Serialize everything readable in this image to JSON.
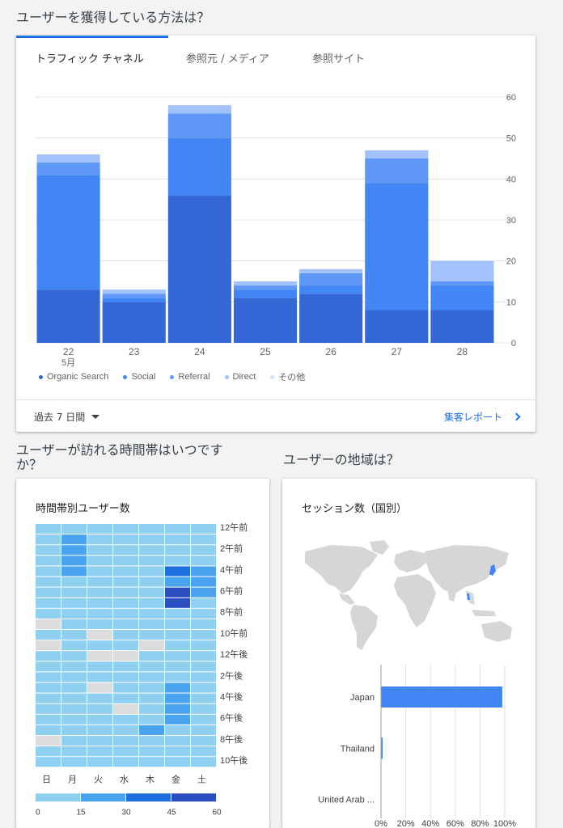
{
  "acquisition": {
    "title": "ユーザーを獲得している方法は？",
    "tabs": [
      "トラフィック チャネル",
      "参照元 / メディア",
      "参照サイト"
    ],
    "active_tab": 0,
    "period_label": "過去 7 日間",
    "report_link": "集客レポート"
  },
  "time_section": {
    "title_line1": "ユーザーが訪れる時間帯はいつです",
    "title_line2": "か？",
    "card_title": "時間帯別ユーザー数"
  },
  "geo_section": {
    "title": "ユーザーの地域は？",
    "card_title": "セッション数（国別）"
  },
  "colors": {
    "organic": "#3367d6",
    "social": "#4285f4",
    "referral": "#5e97f6",
    "direct": "#a1c2fa",
    "other": "#d2e3fc",
    "heat_1": "#8fd0f0",
    "heat_2": "#4aa3ee",
    "heat_3": "#1f6ee0",
    "heat_4": "#2a4dbf",
    "heat_na": "#dcdcdc",
    "map_land": "#d6d6d6",
    "map_highlight": "#4285f4"
  },
  "chart_data": [
    {
      "type": "bar",
      "stacked": true,
      "categories": [
        "22",
        "23",
        "24",
        "25",
        "26",
        "27",
        "28"
      ],
      "x_sublabel": {
        "index": 0,
        "text": "5月"
      },
      "series": [
        {
          "name": "Organic Search",
          "values": [
            13,
            10,
            36,
            11,
            12,
            8,
            8
          ]
        },
        {
          "name": "Social",
          "values": [
            28,
            1,
            14,
            2,
            2,
            31,
            6
          ]
        },
        {
          "name": "Referral",
          "values": [
            3,
            1,
            6,
            1,
            3,
            6,
            1
          ]
        },
        {
          "name": "Direct",
          "values": [
            2,
            1,
            2,
            1,
            1,
            2,
            5
          ]
        },
        {
          "name": "その他",
          "values": [
            0,
            0,
            0,
            0,
            0,
            0,
            0
          ]
        }
      ],
      "ylim": [
        0,
        60
      ],
      "yticks": [
        0,
        10,
        20,
        30,
        40,
        50,
        60
      ],
      "grid": true,
      "legend": "bottom"
    },
    {
      "type": "heatmap",
      "x_labels": [
        "日",
        "月",
        "火",
        "水",
        "木",
        "金",
        "土"
      ],
      "y_labels": [
        "12午前",
        "2午前",
        "4午前",
        "6午前",
        "8午前",
        "10午前",
        "12午後",
        "2午後",
        "4午後",
        "6午後",
        "8午後",
        "10午後"
      ],
      "levels": [
        [
          1,
          1,
          1,
          1,
          1,
          1,
          1
        ],
        [
          1,
          2,
          1,
          1,
          1,
          1,
          1
        ],
        [
          1,
          2,
          1,
          1,
          1,
          1,
          1
        ],
        [
          1,
          2,
          1,
          1,
          1,
          1,
          1
        ],
        [
          1,
          2,
          1,
          1,
          1,
          3,
          2
        ],
        [
          1,
          1,
          1,
          1,
          1,
          2,
          2
        ],
        [
          1,
          1,
          1,
          1,
          1,
          4,
          2
        ],
        [
          1,
          1,
          1,
          1,
          1,
          4,
          1
        ],
        [
          1,
          1,
          1,
          1,
          1,
          1,
          1
        ],
        [
          0,
          1,
          1,
          1,
          1,
          1,
          1
        ],
        [
          1,
          1,
          0,
          1,
          1,
          1,
          1
        ],
        [
          0,
          1,
          1,
          1,
          0,
          1,
          1
        ],
        [
          1,
          1,
          0,
          0,
          1,
          1,
          1
        ],
        [
          1,
          1,
          1,
          1,
          1,
          1,
          1
        ],
        [
          1,
          1,
          1,
          1,
          1,
          1,
          1
        ],
        [
          1,
          1,
          0,
          1,
          1,
          2,
          1
        ],
        [
          1,
          1,
          1,
          1,
          1,
          2,
          1
        ],
        [
          1,
          1,
          1,
          0,
          1,
          2,
          1
        ],
        [
          1,
          1,
          1,
          1,
          1,
          2,
          1
        ],
        [
          1,
          1,
          1,
          1,
          2,
          1,
          1
        ],
        [
          0,
          1,
          1,
          1,
          1,
          1,
          1
        ],
        [
          1,
          1,
          1,
          1,
          1,
          1,
          1
        ],
        [
          1,
          1,
          1,
          1,
          1,
          1,
          1
        ]
      ],
      "scale_ticks": [
        "0",
        "15",
        "30",
        "45",
        "60"
      ]
    },
    {
      "type": "bar",
      "orientation": "horizontal",
      "categories": [
        "Japan",
        "Thailand",
        "United Arab ..."
      ],
      "values": [
        98,
        1,
        0
      ],
      "unit": "%",
      "xticks": [
        "0%",
        "20%",
        "40%",
        "60%",
        "80%",
        "100%"
      ],
      "xlim": [
        0,
        100
      ]
    }
  ]
}
